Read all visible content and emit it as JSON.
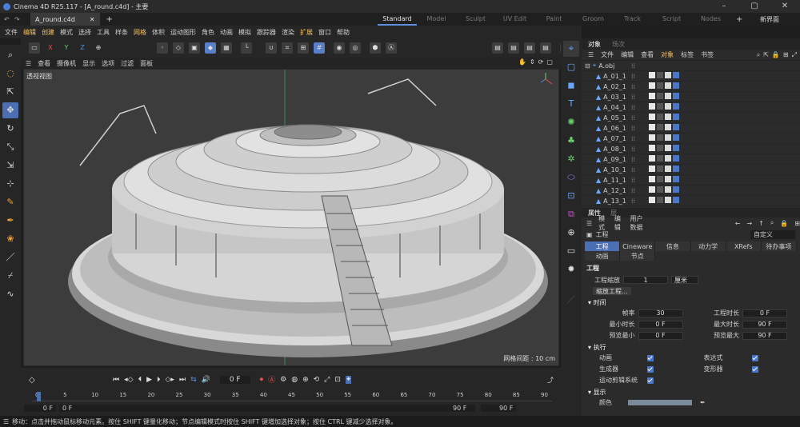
{
  "window": {
    "title": "Cinema 4D R25.117 - [A_round.c4d] - 主要",
    "doc_tab": "A_round.c4d",
    "layouts": [
      "Standard",
      "Model",
      "Sculpt",
      "UV Edit",
      "Paint",
      "Groom",
      "Track",
      "Script",
      "Nodes"
    ],
    "active_layout": "Standard",
    "new_interface": "新界面"
  },
  "menu": [
    "文件",
    "编辑",
    "创建",
    "模式",
    "选择",
    "工具",
    "样条",
    "网格",
    "体积",
    "运动图形",
    "角色",
    "动画",
    "模拟",
    "跟踪器",
    "渲染",
    "扩展",
    "窗口",
    "帮助"
  ],
  "menu_highlight": [
    "编辑",
    "创建",
    "网格",
    "扩展"
  ],
  "toolbar": {
    "axis_x": "X",
    "axis_y": "Y",
    "axis_z": "Z"
  },
  "viewport": {
    "menu": [
      "查看",
      "摄像机",
      "显示",
      "选项",
      "过滤",
      "面板"
    ],
    "label": "透视视图",
    "grid_spacing": "网格间距 : 10 cm"
  },
  "timeline": {
    "frame": "0 F",
    "ticks": [
      "0",
      "5",
      "10",
      "15",
      "20",
      "25",
      "30",
      "35",
      "40",
      "45",
      "50",
      "55",
      "60",
      "65",
      "70",
      "75",
      "80",
      "85",
      "90"
    ],
    "start": "0 F",
    "start2": "0 F",
    "end": "90 F",
    "end2": "90 F",
    "playhead": 0
  },
  "status": "移动：点击并拖动鼠标移动元素。按住 SHIFT 键量化移动；节点编辑模式时按住 SHIFT 键增加选择对象；按住 CTRL 键减少选择对象。",
  "objects": {
    "tabs": [
      "对象",
      "场次"
    ],
    "menu": [
      "文件",
      "编辑",
      "查看",
      "对象",
      "标签",
      "书签"
    ],
    "root": "A.obj",
    "items": [
      "A_01_1",
      "A_02_1",
      "A_03_1",
      "A_04_1",
      "A_05_1",
      "A_06_1",
      "A_07_1",
      "A_08_1",
      "A_09_1",
      "A_10_1",
      "A_11_1",
      "A_12_1",
      "A_13_1"
    ]
  },
  "attributes": {
    "tabs": [
      "属性",
      "层"
    ],
    "menu": [
      "模式",
      "编辑",
      "用户数据"
    ],
    "header": "工程",
    "preset": "自定义",
    "tabs_row1": [
      "工程",
      "Cineware",
      "信息",
      "动力学",
      "XRefs",
      "待办事项"
    ],
    "tabs_row2": [
      "动画",
      "节点"
    ],
    "section": "工程",
    "scale_label": "工程缩放",
    "scale_value": "1",
    "scale_unit": "厘米",
    "scale_button": "缩放工程...",
    "time_section": "时间",
    "fps_label": "帧率",
    "fps": "30",
    "proj_time_label": "工程时长",
    "proj_time": "0 F",
    "min_time_label": "最小时长",
    "min_time": "0 F",
    "max_time_label": "最大时长",
    "max_time": "90 F",
    "preview_min_label": "预览最小",
    "preview_min": "0 F",
    "preview_max_label": "预览最大",
    "preview_max": "90 F",
    "exec_section": "执行",
    "exec": [
      "动画",
      "表达式",
      "生成器",
      "变形器",
      "运动剪辑系统"
    ],
    "display_section": "显示",
    "color_label": "颜色"
  },
  "colors": {
    "accent": "#4c6fb3",
    "highlight": "#f0c060",
    "bg": "#262626"
  }
}
